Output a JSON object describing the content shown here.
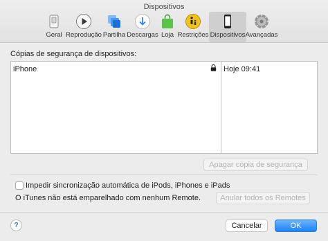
{
  "window": {
    "title": "Dispositivos"
  },
  "toolbar": {
    "tabs": [
      {
        "label": "Geral",
        "icon": "switch-icon"
      },
      {
        "label": "Reprodução",
        "icon": "play-icon"
      },
      {
        "label": "Partilha",
        "icon": "sharing-icon"
      },
      {
        "label": "Descargas",
        "icon": "download-icon"
      },
      {
        "label": "Loja",
        "icon": "store-bag-icon"
      },
      {
        "label": "Restrições",
        "icon": "parental-icon"
      },
      {
        "label": "Dispositivos",
        "icon": "phone-icon",
        "active": true
      },
      {
        "label": "Avançadas",
        "icon": "gear-icon"
      }
    ]
  },
  "backups": {
    "label": "Cópias de segurança de dispositivos:",
    "rows": [
      {
        "name": "iPhone",
        "date": "Hoje 09:41",
        "locked": true
      }
    ],
    "delete_label": "Apagar cópia de segurança"
  },
  "options": {
    "prevent_sync_label": "Impedir sincronização automática de iPods, iPhones e iPads",
    "prevent_sync_checked": false,
    "remote_status": "O iTunes não está emparelhado com nenhum Remote.",
    "forget_remotes_label": "Anular todos os Remotes"
  },
  "footer": {
    "help_label": "?",
    "cancel_label": "Cancelar",
    "ok_label": "OK"
  },
  "colors": {
    "accent": "#1a82fb",
    "active_tab": "#cfcfcf"
  }
}
